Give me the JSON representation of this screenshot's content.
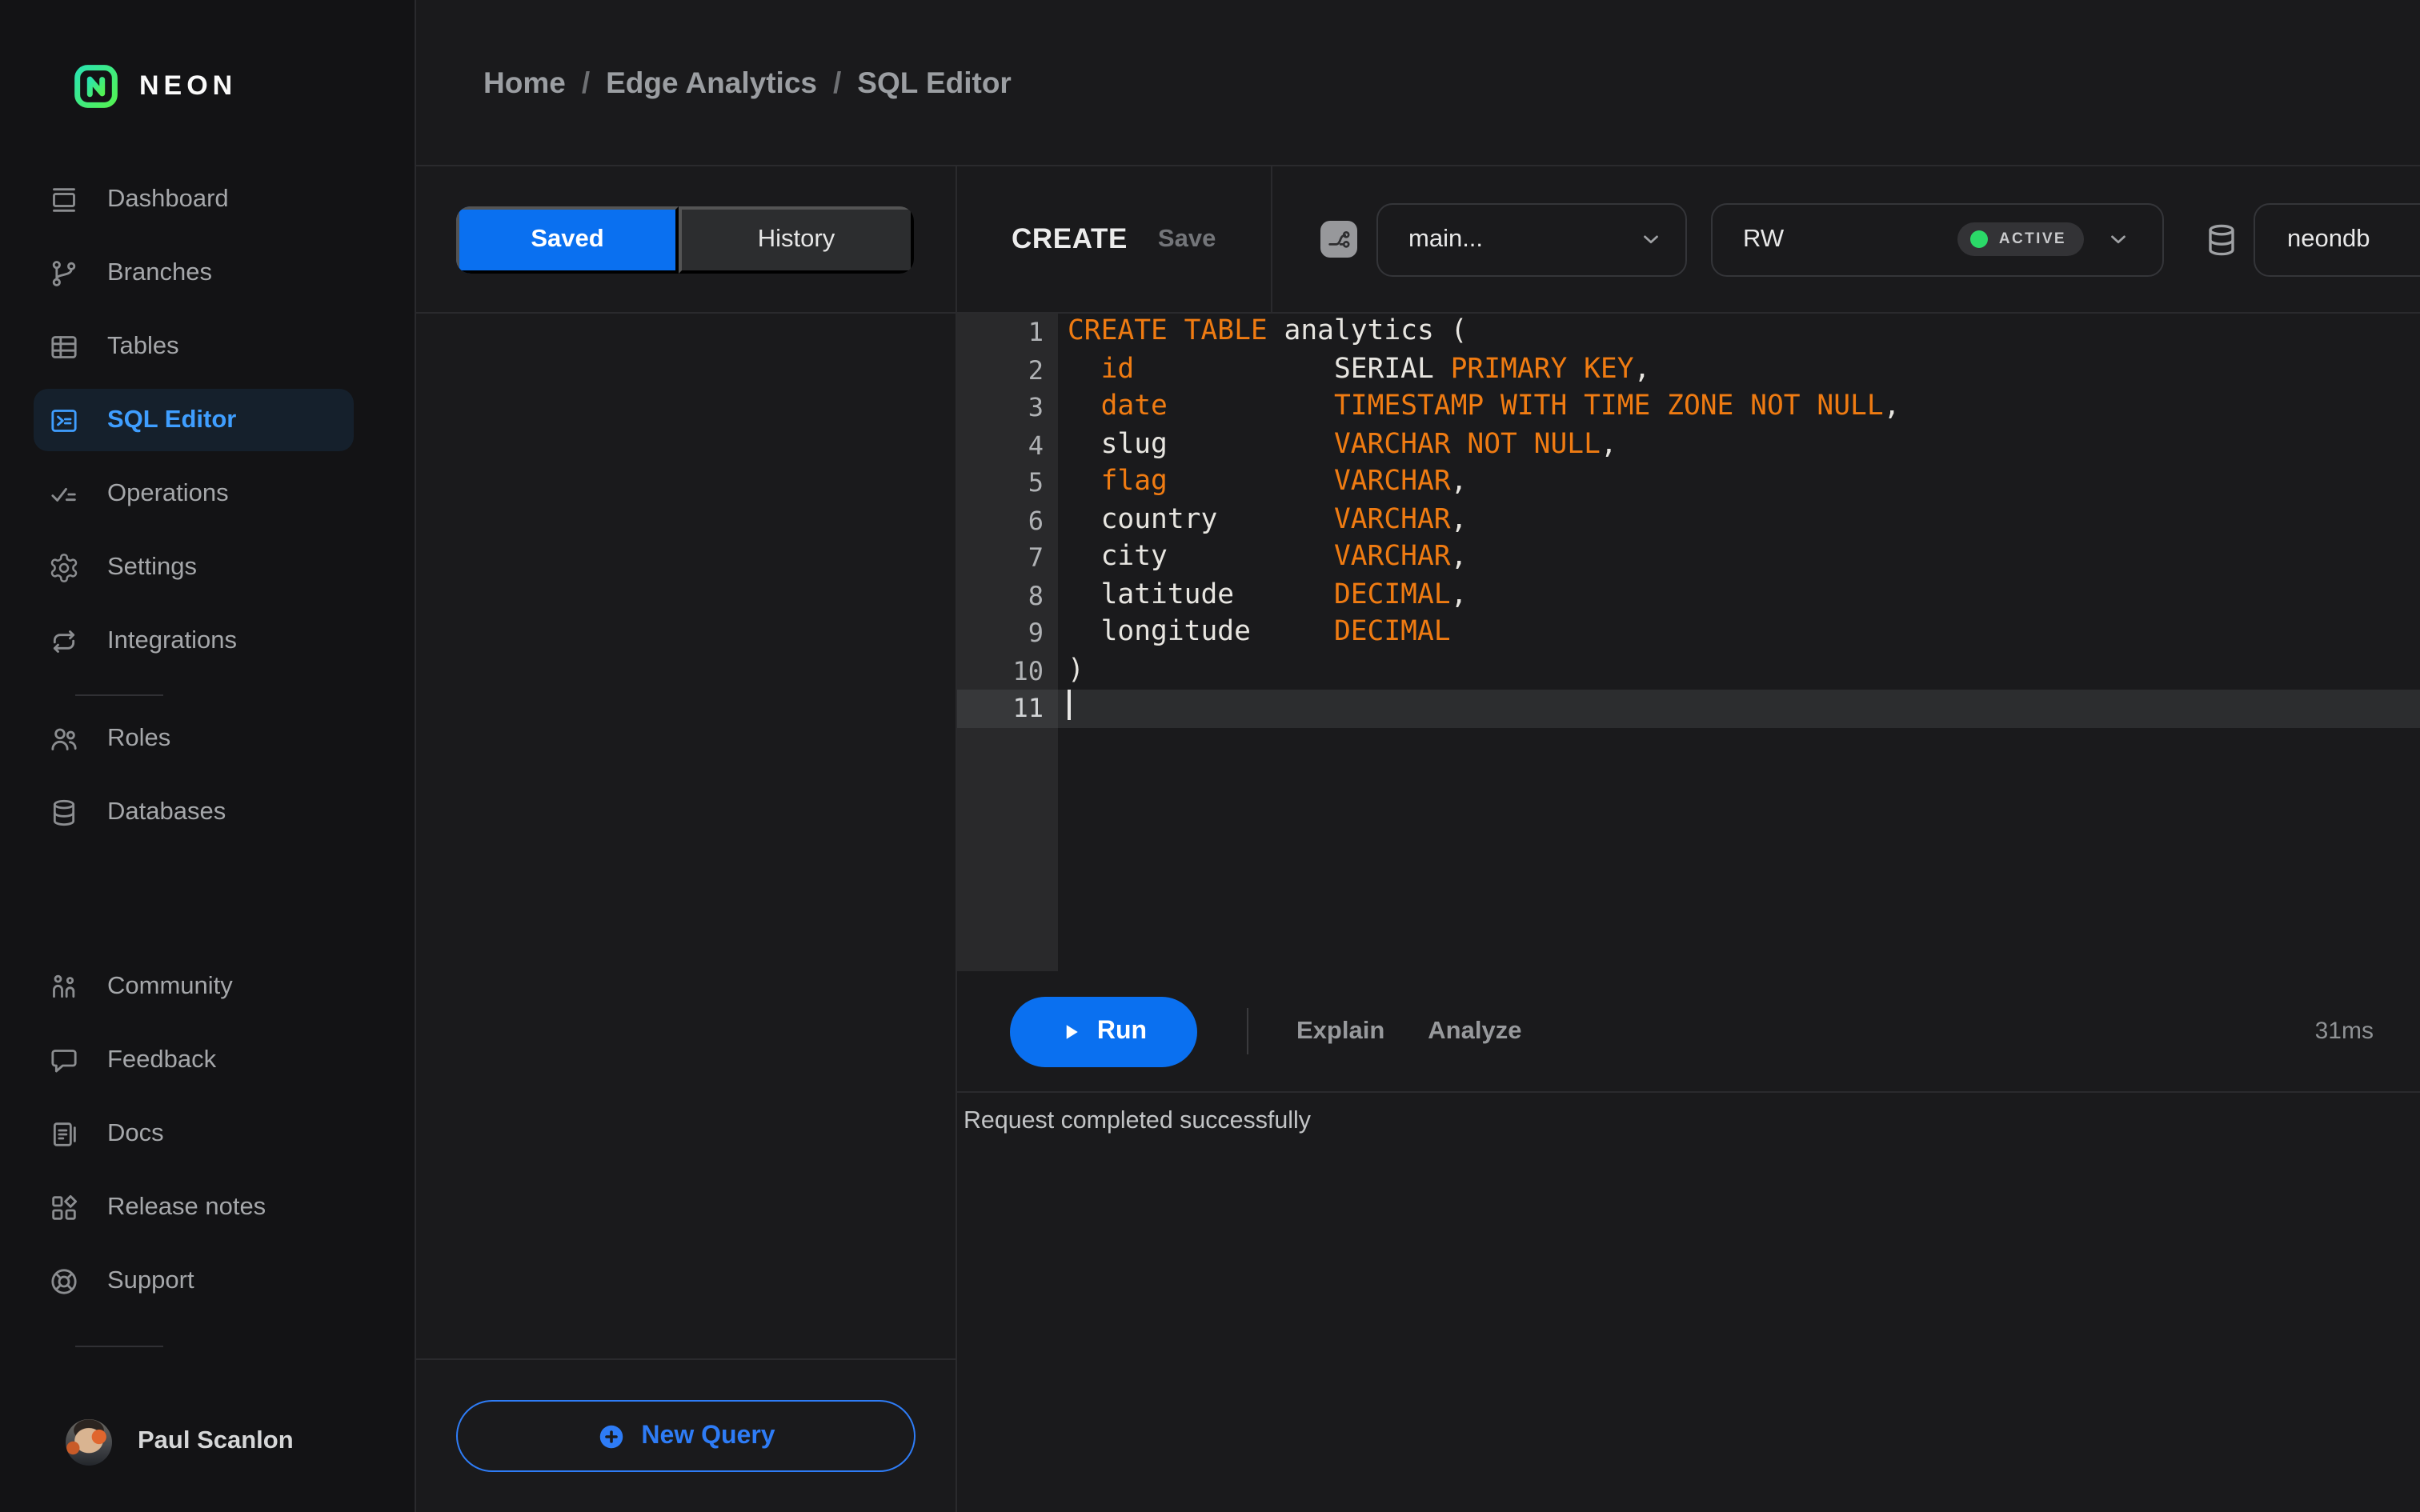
{
  "brand": {
    "name": "NEON"
  },
  "breadcrumb": {
    "separator": "/",
    "items": [
      {
        "label": "Home",
        "link": true
      },
      {
        "label": "Edge Analytics",
        "link": true
      },
      {
        "label": "SQL Editor",
        "link": false
      }
    ]
  },
  "sidebar": {
    "sections": [
      {
        "items": [
          {
            "label": "Dashboard",
            "icon": "dashboard-icon",
            "active": false
          },
          {
            "label": "Branches",
            "icon": "branches-icon",
            "active": false
          },
          {
            "label": "Tables",
            "icon": "tables-icon",
            "active": false
          },
          {
            "label": "SQL Editor",
            "icon": "sql-editor-icon",
            "active": true
          },
          {
            "label": "Operations",
            "icon": "operations-icon",
            "active": false
          },
          {
            "label": "Settings",
            "icon": "gear-icon",
            "active": false
          },
          {
            "label": "Integrations",
            "icon": "integrations-icon",
            "active": false
          }
        ]
      },
      {
        "items": [
          {
            "label": "Roles",
            "icon": "roles-icon",
            "active": false
          },
          {
            "label": "Databases",
            "icon": "database-icon",
            "active": false
          }
        ]
      },
      {
        "items": [
          {
            "label": "Community",
            "icon": "community-icon",
            "active": false
          },
          {
            "label": "Feedback",
            "icon": "feedback-icon",
            "active": false
          },
          {
            "label": "Docs",
            "icon": "docs-icon",
            "active": false
          },
          {
            "label": "Release notes",
            "icon": "release-notes-icon",
            "active": false
          },
          {
            "label": "Support",
            "icon": "support-icon",
            "active": false
          }
        ]
      }
    ],
    "user": {
      "name": "Paul Scanlon"
    }
  },
  "saved_panel": {
    "tabs": [
      {
        "label": "Saved",
        "active": true
      },
      {
        "label": "History",
        "active": false
      }
    ],
    "new_query_label": "New Query"
  },
  "editor": {
    "title": "CREATE",
    "save_label": "Save",
    "branch_select": {
      "value": "main..."
    },
    "compute_select": {
      "value": "RW",
      "status": "ACTIVE"
    },
    "database_select": {
      "value": "neondb"
    },
    "active_line": 11,
    "lines": [
      {
        "num": 1,
        "segments": [
          {
            "text": "CREATE TABLE",
            "type": "kw"
          },
          {
            "text": " analytics (",
            "type": "pl"
          }
        ]
      },
      {
        "num": 2,
        "segments": [
          {
            "text": "  ",
            "type": "pl"
          },
          {
            "text": "id",
            "type": "kw"
          },
          {
            "text": "            SERIAL ",
            "type": "pl"
          },
          {
            "text": "PRIMARY KEY",
            "type": "kw"
          },
          {
            "text": ",",
            "type": "pl"
          }
        ]
      },
      {
        "num": 3,
        "segments": [
          {
            "text": "  ",
            "type": "pl"
          },
          {
            "text": "date",
            "type": "kw"
          },
          {
            "text": "          ",
            "type": "pl"
          },
          {
            "text": "TIMESTAMP WITH TIME ZONE NOT NULL",
            "type": "kw"
          },
          {
            "text": ",",
            "type": "pl"
          }
        ]
      },
      {
        "num": 4,
        "segments": [
          {
            "text": "  slug          ",
            "type": "pl"
          },
          {
            "text": "VARCHAR NOT NULL",
            "type": "kw"
          },
          {
            "text": ",",
            "type": "pl"
          }
        ]
      },
      {
        "num": 5,
        "segments": [
          {
            "text": "  ",
            "type": "pl"
          },
          {
            "text": "flag",
            "type": "kw"
          },
          {
            "text": "          ",
            "type": "pl"
          },
          {
            "text": "VARCHAR",
            "type": "kw"
          },
          {
            "text": ",",
            "type": "pl"
          }
        ]
      },
      {
        "num": 6,
        "segments": [
          {
            "text": "  country       ",
            "type": "pl"
          },
          {
            "text": "VARCHAR",
            "type": "kw"
          },
          {
            "text": ",",
            "type": "pl"
          }
        ]
      },
      {
        "num": 7,
        "segments": [
          {
            "text": "  city          ",
            "type": "pl"
          },
          {
            "text": "VARCHAR",
            "type": "kw"
          },
          {
            "text": ",",
            "type": "pl"
          }
        ]
      },
      {
        "num": 8,
        "segments": [
          {
            "text": "  latitude      ",
            "type": "pl"
          },
          {
            "text": "DECIMAL",
            "type": "kw"
          },
          {
            "text": ",",
            "type": "pl"
          }
        ]
      },
      {
        "num": 9,
        "segments": [
          {
            "text": "  longitude     ",
            "type": "pl"
          },
          {
            "text": "DECIMAL",
            "type": "kw"
          }
        ]
      },
      {
        "num": 10,
        "segments": [
          {
            "text": ")",
            "type": "pl"
          }
        ]
      },
      {
        "num": 11,
        "segments": [],
        "cursor": true
      }
    ]
  },
  "toolbar": {
    "run_label": "Run",
    "explain_label": "Explain",
    "analyze_label": "Analyze",
    "duration": "31ms"
  },
  "status": {
    "message": "Request completed successfully"
  },
  "colors": {
    "accent_blue": "#0a70f0",
    "keyword_orange": "#ef7b12",
    "status_green": "#2bd968",
    "nav_active_blue": "#3f9eff",
    "link_blue": "#2e7cf6",
    "logo_gradient_start": "#2be4b0",
    "logo_gradient_end": "#53f252"
  }
}
